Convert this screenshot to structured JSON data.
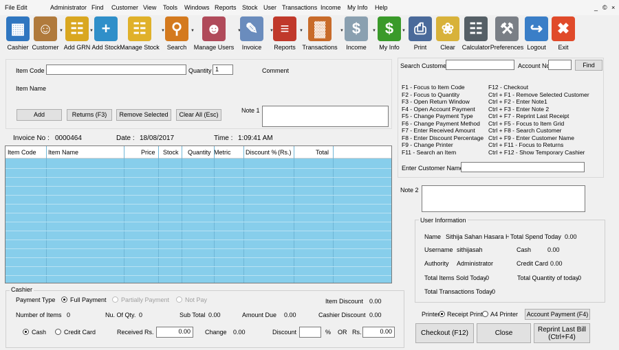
{
  "menu": [
    "File",
    "Edit",
    "Administrator",
    "Find",
    "Customer",
    "View",
    "Tools",
    "Windows",
    "Reports",
    "Stock",
    "User",
    "Transactions",
    "Income",
    "My Info",
    "Help"
  ],
  "window_controls": {
    "minimize": "_",
    "restore": "©",
    "close": "×"
  },
  "toolbar": [
    {
      "label": "Cashier",
      "icon": "cashier-register-icon",
      "glyph": "▦",
      "color": "#2f76c0"
    },
    {
      "label": "Customer",
      "icon": "customer-person-icon",
      "glyph": "☺",
      "color": "#b07a3c"
    },
    {
      "label": "Add GRN",
      "icon": "add-grn-basket-icon",
      "glyph": "☷",
      "color": "#d9a720"
    },
    {
      "label": "Add Stock",
      "icon": "add-stock-cart-icon",
      "glyph": "+",
      "color": "#2f8fc9"
    },
    {
      "label": "Manage Stock",
      "icon": "manage-stock-basket-icon",
      "glyph": "☷",
      "color": "#e0b12a"
    },
    {
      "label": "Search",
      "icon": "search-magnifier-icon",
      "glyph": "⚲",
      "color": "#d47a1e"
    },
    {
      "label": "Manage Users",
      "icon": "manage-users-icon",
      "glyph": "☻",
      "color": "#b04a5a"
    },
    {
      "label": "Invoice",
      "icon": "invoice-document-icon",
      "glyph": "✎",
      "color": "#6a8cbd"
    },
    {
      "label": "Reports",
      "icon": "reports-magnifier-icon",
      "glyph": "≡",
      "color": "#c0392b"
    },
    {
      "label": "Transactions",
      "icon": "transactions-chart-icon",
      "glyph": "▓",
      "color": "#c86b2a"
    },
    {
      "label": "Income",
      "icon": "income-coins-icon",
      "glyph": "$",
      "color": "#8aa0b0"
    },
    {
      "label": "My Info",
      "icon": "my-info-dollar-icon",
      "glyph": "$",
      "color": "#3a9a2a"
    },
    {
      "label": "Print",
      "icon": "printer-icon",
      "glyph": "⎙",
      "color": "#4a6a9a"
    },
    {
      "label": "Clear",
      "icon": "broom-clear-icon",
      "glyph": "❀",
      "color": "#d8b23a"
    },
    {
      "label": "Calculator",
      "icon": "calculator-icon",
      "glyph": "☷",
      "color": "#555f66"
    },
    {
      "label": "Preferences",
      "icon": "preferences-tools-icon",
      "glyph": "⚒",
      "color": "#7a7f86"
    },
    {
      "label": "Logout",
      "icon": "logout-door-icon",
      "glyph": "↪",
      "color": "#3a7ec7"
    },
    {
      "label": "Exit",
      "icon": "exit-x-icon",
      "glyph": "✖",
      "color": "#e04a2a"
    }
  ],
  "item_entry": {
    "item_code_label": "Item Code",
    "item_code_value": "",
    "quantity_label": "Quantity",
    "quantity_value": "1",
    "comment_label": "Comment",
    "item_name_label": "Item Name",
    "add_button": "Add",
    "returns_button": "Returns (F3)",
    "remove_button": "Remove Selected",
    "clear_all_button": "Clear All (Esc)",
    "note1_label": "Note 1",
    "note1_value": ""
  },
  "invoice": {
    "invoice_no_label": "Invoice No :",
    "invoice_no": "0000464",
    "date_label": "Date :",
    "date": "18/08/2017",
    "time_label": "Time :",
    "time": "1:09:41 AM"
  },
  "grid": {
    "columns": [
      "Item Code",
      "Item Name",
      "Price",
      "Stock",
      "Quantity",
      "Metric",
      "Discount %",
      "(Rs.)",
      "Total"
    ],
    "rows": []
  },
  "cashier": {
    "group_title": "Cashier",
    "payment_type_label": "Payment Type",
    "full_payment": "Full Payment",
    "partial_payment": "Partially Payment",
    "not_pay": "Not Pay",
    "item_discount_label": "Item Discount",
    "item_discount": "0.00",
    "num_items_label": "Number of Items",
    "num_items": "0",
    "num_qty_label": "Nu. Of Qty.",
    "num_qty": "0",
    "sub_total_label": "Sub Total",
    "sub_total": "0.00",
    "amount_due_label": "Amount Due",
    "amount_due": "0.00",
    "cashier_discount_label": "Cashier Discount",
    "cashier_discount": "0.00",
    "cash_label": "Cash",
    "credit_card_label": "Credit Card",
    "received_label": "Received Rs.",
    "received_value": "0.00",
    "change_label": "Change",
    "change": "0.00",
    "discount_label": "Discount",
    "discount_value": "",
    "percent_sign": "%",
    "or_label": "OR",
    "rs_label": "Rs.",
    "rs_value": "0.00"
  },
  "customer_search": {
    "search_label": "Search Customer",
    "search_value": "",
    "account_no_label": "Account No",
    "account_no_value": "",
    "find_button": "Find"
  },
  "shortcuts_left": [
    "F1 - Focus to Item Code",
    "F2 - Focus to Quantity",
    "F3 - Open Return Window",
    "F4 - Open Account Payment",
    "F5 - Change Payment Type",
    "F6 - Change Payment Method",
    "F7 - Enter Received Amount",
    "F8 - Enter Discount Percentage",
    "F9 - Change Printer",
    "F11 - Search an Item"
  ],
  "shortcuts_right": [
    "F12 - Checkout",
    "Ctrl + F1 - Remove Selected Customer",
    "Ctrl + F2 - Enter Note1",
    "Ctrl + F3 - Enter Note 2",
    "Ctrl + F7 - Reprint Last Receipt",
    "Ctrl + F5 - Focus to Item Grid",
    "Ctrl + F8 - Search Customer",
    "Ctrl + F9 - Enter Customer Name",
    "Ctrl + F11 - Focus to Returns",
    "Ctrl + F12 - Show Temporary Cashier"
  ],
  "customer_name": {
    "label": "Enter Customer Name",
    "value": ""
  },
  "note2": {
    "label": "Note 2",
    "value": ""
  },
  "user_info": {
    "group_title": "User Information",
    "name_label": "Name",
    "name": "Sithija Sahan Hasara Hev",
    "total_spend_label": "Total Spend Today",
    "total_spend": "0.00",
    "username_label": "Username",
    "username": "sithijasah",
    "cash_label": "Cash",
    "cash": "0.00",
    "authority_label": "Authority",
    "authority": "Administrator",
    "credit_card_label": "Credit Card",
    "credit_card": "0.00",
    "items_sold_label": "Total Items Sold Today",
    "items_sold": "0",
    "total_qty_label": "Total Quantity of today",
    "total_qty": "0",
    "transactions_label": "Total Transactions Today",
    "transactions": "0"
  },
  "printer": {
    "label": "Printer",
    "receipt_printer": "Receipt Printer",
    "a4_printer": "A4 Printer",
    "account_payment_button": "Account Payment (F4)"
  },
  "actions": {
    "checkout": "Checkout (F12)",
    "close": "Close",
    "reprint_line1": "Reprint Last Bill",
    "reprint_line2": "(Ctrl+F4)"
  }
}
